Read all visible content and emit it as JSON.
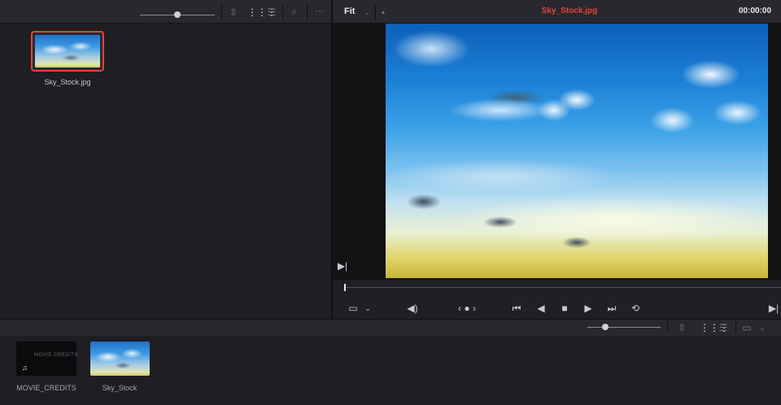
{
  "media_pool": {
    "clips": [
      {
        "name": "Sky_Stock.jpg",
        "selected": true
      }
    ],
    "toolbar_icons": [
      "zoom-slider",
      "sort-icon",
      "thumbnail-view-icon",
      "list-view-icon",
      "search-icon",
      "more-options-icon"
    ]
  },
  "viewer": {
    "zoom": "Fit",
    "title": "Sky_Stock.jpg",
    "timecode": "00:00:00",
    "title_color": "#e0453a"
  },
  "transport": {
    "icons": [
      "viewer-mode-icon",
      "audio-icon",
      "jog-icon",
      "go-to-start-icon",
      "play-reverse-icon",
      "stop-icon",
      "play-icon",
      "go-to-end-icon",
      "loop-icon",
      "next-frame-icon"
    ]
  },
  "bin": {
    "items": [
      {
        "name": "MOVIE_CREDITS",
        "thumb_text": "MOVIE CREDITS",
        "type": "audio-title"
      },
      {
        "name": "Sky_Stock",
        "type": "image"
      }
    ]
  },
  "colors": {
    "accent": "#e0453a",
    "panel": "#1e1e23",
    "toolbar": "#28282e"
  }
}
